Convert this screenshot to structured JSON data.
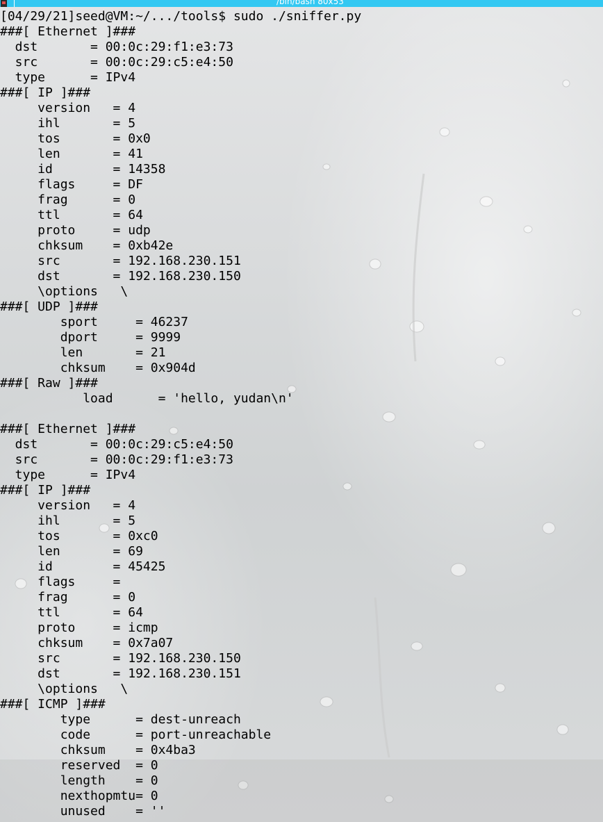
{
  "window": {
    "title": "/bin/bash 80x53"
  },
  "terminal": {
    "lines": [
      "[04/29/21]seed@VM:~/.../tools$ sudo ./sniffer.py",
      "###[ Ethernet ]###",
      "  dst       = 00:0c:29:f1:e3:73",
      "  src       = 00:0c:29:c5:e4:50",
      "  type      = IPv4",
      "###[ IP ]###",
      "     version   = 4",
      "     ihl       = 5",
      "     tos       = 0x0",
      "     len       = 41",
      "     id        = 14358",
      "     flags     = DF",
      "     frag      = 0",
      "     ttl       = 64",
      "     proto     = udp",
      "     chksum    = 0xb42e",
      "     src       = 192.168.230.151",
      "     dst       = 192.168.230.150",
      "     \\options   \\",
      "###[ UDP ]###",
      "        sport     = 46237",
      "        dport     = 9999",
      "        len       = 21",
      "        chksum    = 0x904d",
      "###[ Raw ]###",
      "           load      = 'hello, yudan\\n'",
      "",
      "###[ Ethernet ]###",
      "  dst       = 00:0c:29:c5:e4:50",
      "  src       = 00:0c:29:f1:e3:73",
      "  type      = IPv4",
      "###[ IP ]###",
      "     version   = 4",
      "     ihl       = 5",
      "     tos       = 0xc0",
      "     len       = 69",
      "     id        = 45425",
      "     flags     = ",
      "     frag      = 0",
      "     ttl       = 64",
      "     proto     = icmp",
      "     chksum    = 0x7a07",
      "     src       = 192.168.230.150",
      "     dst       = 192.168.230.151",
      "     \\options   \\",
      "###[ ICMP ]###",
      "        type      = dest-unreach",
      "        code      = port-unreachable",
      "        chksum    = 0x4ba3",
      "        reserved  = 0",
      "        length    = 0",
      "        nexthopmtu= 0",
      "        unused    = ''"
    ]
  }
}
